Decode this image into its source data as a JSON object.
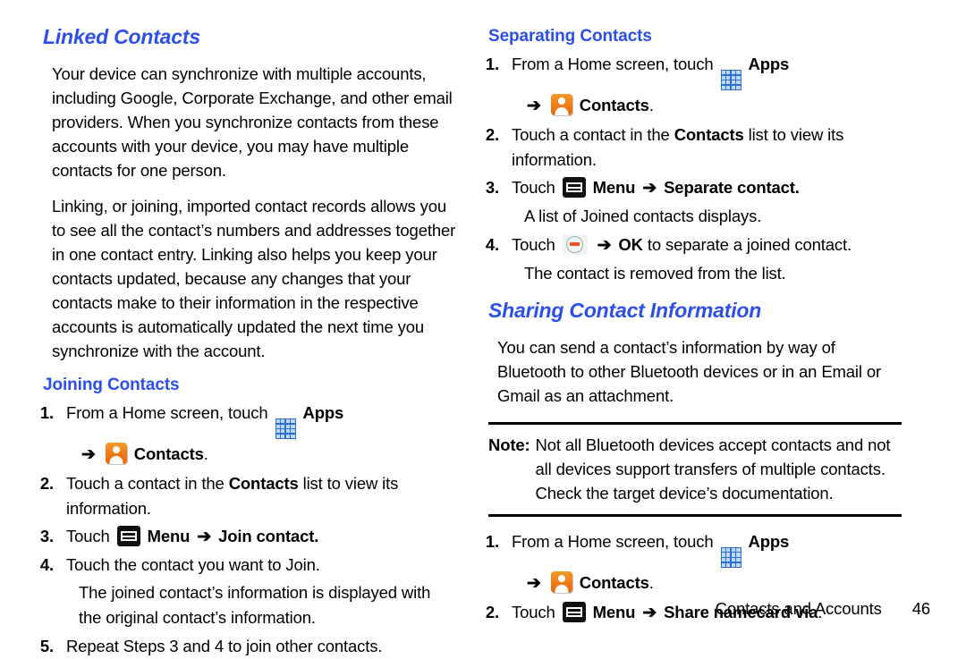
{
  "left_column": {
    "heading": "Linked Contacts",
    "paragraphs": [
      "Your device can synchronize with multiple accounts, including Google, Corporate Exchange, and other email providers. When you synchronize contacts from these accounts with your device, you may have multiple contacts for one person.",
      "Linking, or joining, imported contact records allows you to see all the contact’s numbers and addresses together in one contact entry. Linking also helps you keep your contacts updated, because any changes that your contacts make to their information in the respective accounts is automatically updated the next time you synchronize with the account."
    ],
    "subheading": "Joining Contacts",
    "steps": {
      "s1_num": "1.",
      "s1_text": "From a Home screen, touch",
      "s1_apps": "Apps",
      "s1_contacts": "Contacts",
      "s1_period": ".",
      "s2_num": "2.",
      "s2_a": "Touch a contact in the",
      "s2_b": "Contacts",
      "s2_c": "list to view its information.",
      "s3_num": "3.",
      "s3_touch": "Touch",
      "s3_menu": "Menu",
      "s3_action": "Join contact.",
      "s4_num": "4.",
      "s4_text": "Touch the contact you want to Join.",
      "s4_note": "The joined contact’s information is displayed with the original contact’s information.",
      "s5_num": "5.",
      "s5_text": "Repeat Steps 3 and 4 to join other contacts."
    }
  },
  "right_column": {
    "subheading": "Separating Contacts",
    "sep_steps": {
      "s1_num": "1.",
      "s1_text": "From a Home screen, touch",
      "s1_apps": "Apps",
      "s1_contacts": "Contacts",
      "s1_period": ".",
      "s2_num": "2.",
      "s2_a": "Touch a contact in the",
      "s2_b": "Contacts",
      "s2_c": "list to view its information.",
      "s3_num": "3.",
      "s3_touch": "Touch",
      "s3_menu": "Menu",
      "s3_action": "Separate contact.",
      "s3_note": "A list of Joined contacts displays.",
      "s4_num": "4.",
      "s4_touch": "Touch",
      "s4_ok": "OK",
      "s4_tail": "to separate a joined contact.",
      "s4_note": "The contact is removed from the list."
    },
    "heading": "Sharing Contact Information",
    "paragraph": "You can send a contact’s information by way of Bluetooth to other Bluetooth devices or in an Email or Gmail as an attachment.",
    "note": {
      "label": "Note:",
      "text": "Not all Bluetooth devices accept contacts and not all devices support transfers of multiple contacts. Check the target device’s documentation."
    },
    "share_steps": {
      "s1_num": "1.",
      "s1_text": "From a Home screen, touch",
      "s1_apps": "Apps",
      "s1_contacts": "Contacts",
      "s1_period": ".",
      "s2_num": "2.",
      "s2_touch": "Touch",
      "s2_menu": "Menu",
      "s2_action": "Share namecard via",
      "s2_period": "."
    }
  },
  "footer": {
    "section": "Contacts and Accounts",
    "page": "46"
  },
  "symbols": {
    "arrow": "➔"
  },
  "colors": {
    "heading_blue": "#2b4fe8",
    "contacts_orange": "#ee7a16",
    "apps_blue": "#2f6fd0",
    "text_black": "#000000"
  }
}
